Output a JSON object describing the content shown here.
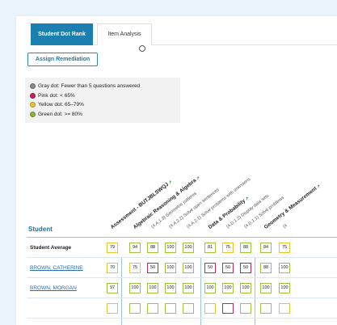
{
  "tabs": [
    {
      "label": "Student Dot Rank",
      "active": true
    },
    {
      "label": "Item Analysis",
      "active": false
    }
  ],
  "assign_button": "Assign Remediation",
  "legend": [
    {
      "label": "Gray dot: Fewer than 5 questions answered",
      "color": "#8a8a8a"
    },
    {
      "label": "Pink dot: < 65%",
      "color": "#c2255c"
    },
    {
      "label": "Yellow dot: 65–79%",
      "color": "#e9c22c"
    },
    {
      "label": "Green dot: >= 80%",
      "color": "#8fb33a"
    }
  ],
  "student_header": "Student",
  "columns": [
    {
      "label": "Assessment - BUTJBLSWQJ",
      "kind": "assess"
    },
    {
      "label": "Algebraic Reasoning & Algebra",
      "kind": "domain"
    },
    {
      "label": "(4.A.1.3) Geometric patterns",
      "kind": "std"
    },
    {
      "label": "(4.A.2.2) Solve open sentences",
      "kind": "std"
    },
    {
      "label": "(4.A.2.1) Solve problems with unknowns",
      "kind": "std"
    },
    {
      "label": "Data & Probability",
      "kind": "domain"
    },
    {
      "label": "(4.D.1.2) Display data sets",
      "kind": "std"
    },
    {
      "label": "(4.D.1.1) Solve problems",
      "kind": "std"
    },
    {
      "label": "Geometry & Measurement",
      "kind": "domain"
    },
    {
      "label": "(4",
      "kind": "std"
    }
  ],
  "rows": [
    {
      "name": "Student Average",
      "style": "bold",
      "values": [
        "79",
        "94",
        "88",
        "100",
        "100",
        "81",
        "75",
        "88",
        "84",
        "75"
      ],
      "colors": [
        "yellow",
        "green",
        "green",
        "green",
        "green",
        "green",
        "yellow",
        "green",
        "green",
        "yellow"
      ]
    },
    {
      "name": "BROWN, CATHERINE",
      "style": "link",
      "values": [
        "70",
        "75",
        "50",
        "100",
        "100",
        "50",
        "50",
        "50",
        "88",
        "100"
      ],
      "colors": [
        "yellow",
        "yellow",
        "pink",
        "green",
        "green",
        "pink",
        "pink",
        "pink",
        "green",
        "green"
      ]
    },
    {
      "name": "BROWN, MORGAN",
      "style": "link",
      "values": [
        "97",
        "100",
        "100",
        "100",
        "100",
        "100",
        "100",
        "100",
        "100",
        "100"
      ],
      "colors": [
        "green",
        "green",
        "green",
        "green",
        "green",
        "green",
        "green",
        "green",
        "green",
        "green"
      ]
    },
    {
      "name": "",
      "style": "link",
      "values": [
        "",
        "",
        "",
        "",
        "",
        "",
        "",
        "",
        "",
        ""
      ],
      "colors": [
        "yellow",
        "green",
        "green",
        "green",
        "green",
        "yellow",
        "pink",
        "green",
        "green",
        "yellow"
      ]
    }
  ]
}
